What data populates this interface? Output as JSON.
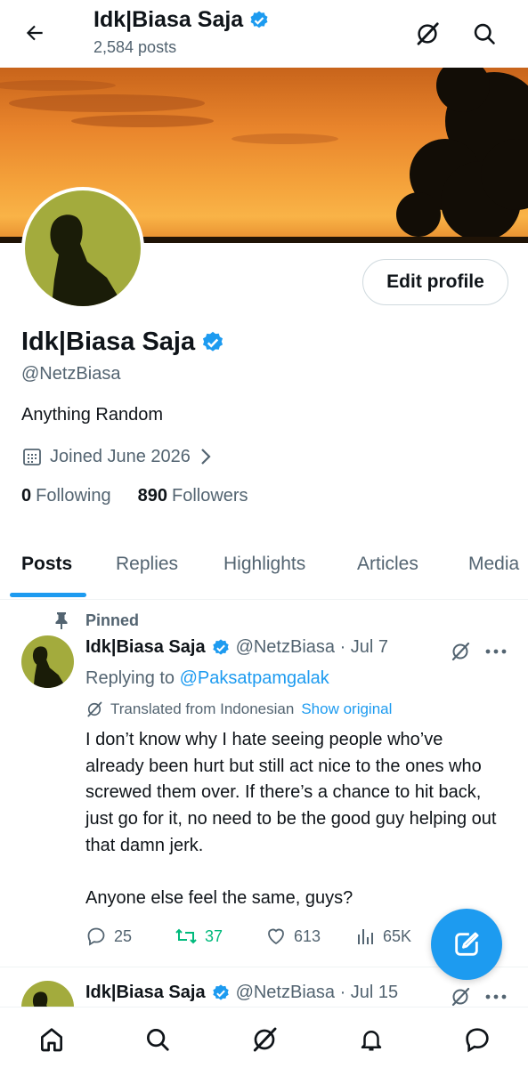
{
  "header": {
    "name": "Idk|Biasa Saja",
    "posts_count": "2,584 posts",
    "icons": [
      "back-arrow-icon",
      "grok-icon",
      "search-icon"
    ]
  },
  "profile": {
    "name": "Idk|Biasa Saja",
    "handle": "@NetzBiasa",
    "bio": "Anything Random",
    "joined": "Joined June 2026",
    "following_count": "0",
    "following_label": "Following",
    "followers_count": "890",
    "followers_label": "Followers",
    "edit_profile_label": "Edit profile",
    "verified_color": "#1d9bf0"
  },
  "tabs": [
    {
      "label": "Posts",
      "active": true
    },
    {
      "label": "Replies"
    },
    {
      "label": "Highlights"
    },
    {
      "label": "Articles"
    },
    {
      "label": "Media"
    }
  ],
  "pinned_post": {
    "pinned_label": "Pinned",
    "name": "Idk|Biasa Saja",
    "meta": "@NetzBiasa · Jul 7",
    "replying_prefix": "Replying to",
    "replying_to": "@Paksatpamgalak",
    "translated_label": "Translated from Indonesian",
    "show_original": "Show original",
    "body_1": "I don’t know why I hate seeing people who’ve already been hurt but still act nice to the ones who screwed them over. If there’s a chance to hit back, just go for it, no need to be the good guy helping out that damn jerk.",
    "body_2": "Anyone else feel the same, guys?",
    "replies": "25",
    "reposts": "37",
    "likes": "613",
    "views": "65K"
  },
  "next_post": {
    "name": "Idk|Biasa Saja",
    "meta": "@NetzBiasa · Jul 15"
  },
  "colors": {
    "accent": "#1d9bf0",
    "repost_active": "#00ba7c",
    "secondary_text": "#536471",
    "avatar_bg": "#a3ab3d"
  },
  "bottom_nav": [
    "home-icon",
    "search-icon",
    "grok-icon",
    "notifications-icon",
    "messages-icon"
  ]
}
